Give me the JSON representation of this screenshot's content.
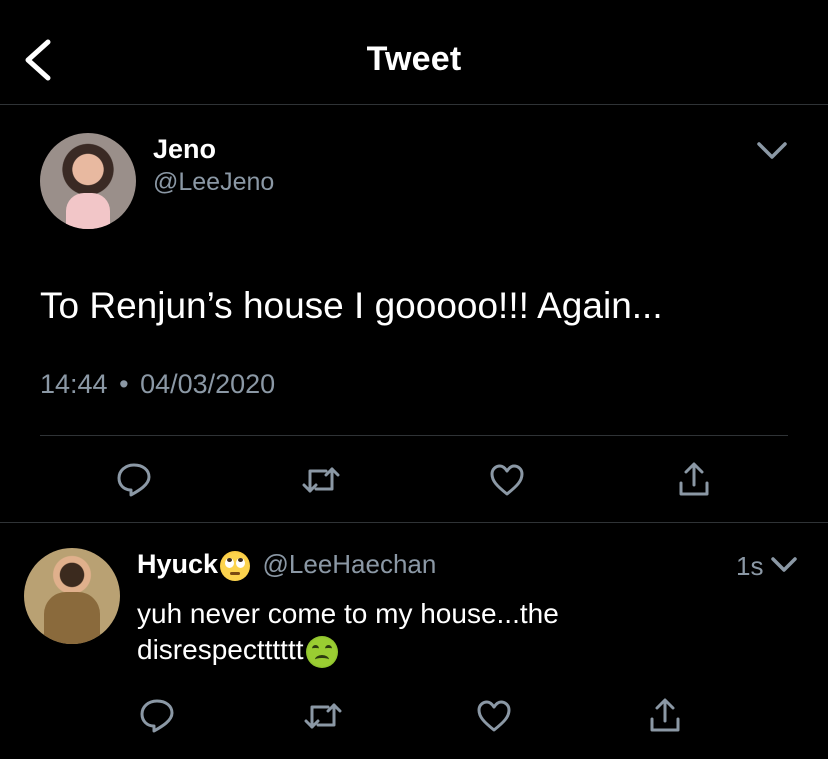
{
  "header": {
    "title": "Tweet"
  },
  "main_tweet": {
    "name": "Jeno",
    "handle": "@LeeJeno",
    "text": "To Renjun’s house I gooooo!!! Again...",
    "time": "14:44",
    "separator": "•",
    "date": "04/03/2020"
  },
  "reply": {
    "name": "Hyuck",
    "name_emoji": "eye-roll-emoji",
    "handle": "@LeeHaechan",
    "age": "1s",
    "text": "yuh never come to my house...the disrespectttttt",
    "text_emoji": "nauseated-face-emoji"
  },
  "colors": {
    "background": "#000000",
    "muted": "#8b98a5",
    "divider": "#2f3336"
  }
}
